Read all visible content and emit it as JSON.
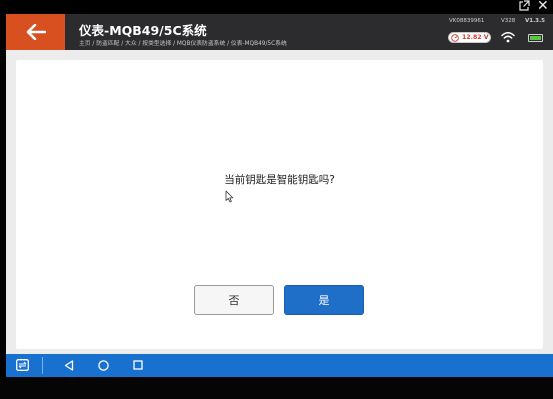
{
  "window": {
    "external_icon": "external-link-icon",
    "close_glyph": "✕"
  },
  "header": {
    "title": "仪表-MQB49/5C系统",
    "breadcrumb": "主页 / 防盗匹配 / 大众 / 按类型选择 / MQB仪表防盗系统 / 仪表-MQB49/5C系统",
    "vin": "VK08839961",
    "software_version": "V328",
    "app_version": "V1.3.5",
    "voltage": "12.82 V",
    "accent_color": "#d8501f",
    "battery_level": 1.0
  },
  "dialog": {
    "question": "当前钥匙是智能钥匙吗?",
    "no_label": "否",
    "yes_label": "是",
    "yes_color": "#1f6ec7"
  },
  "navbar": {
    "color": "#1870cf",
    "icons": [
      "app-switch-icon",
      "back-triangle-icon",
      "home-circle-icon",
      "recent-square-icon"
    ]
  }
}
